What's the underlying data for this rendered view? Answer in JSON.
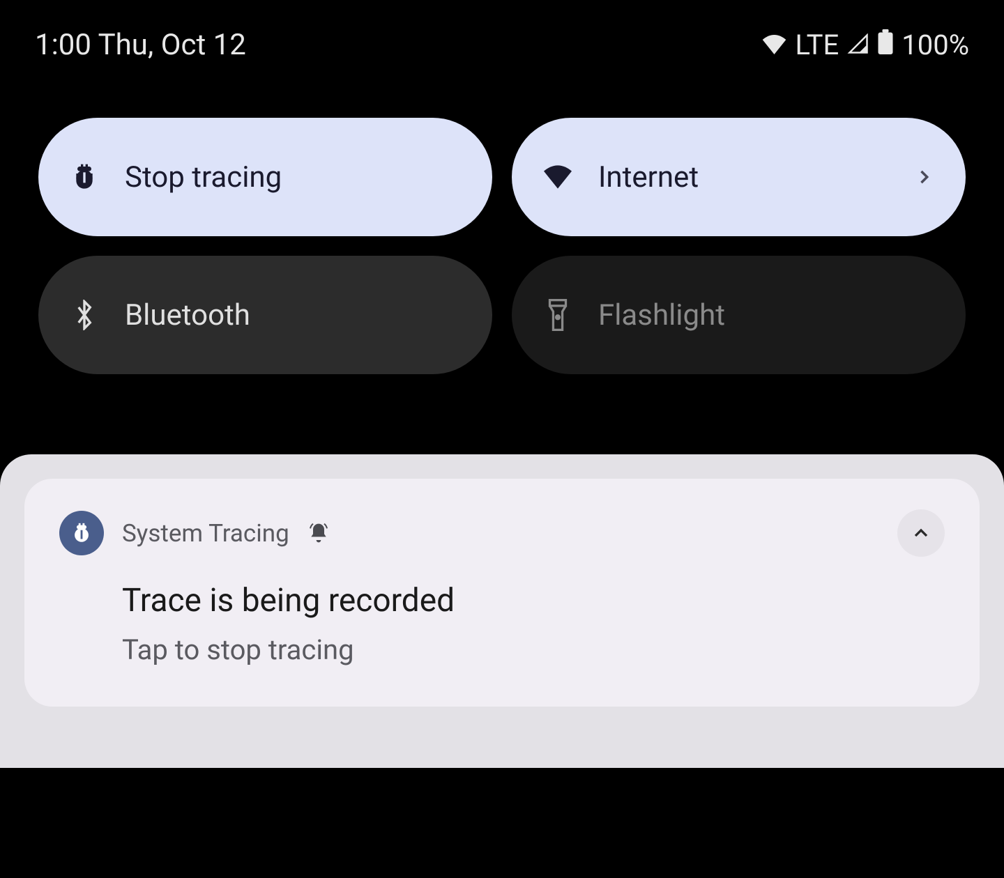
{
  "status": {
    "time": "1:00",
    "date": "Thu, Oct 12",
    "network_type": "LTE",
    "battery": "100%"
  },
  "tiles": {
    "stop_tracing": "Stop tracing",
    "internet": "Internet",
    "bluetooth": "Bluetooth",
    "flashlight": "Flashlight"
  },
  "notification": {
    "app_name": "System Tracing",
    "title": "Trace is being recorded",
    "subtitle": "Tap to stop tracing"
  }
}
